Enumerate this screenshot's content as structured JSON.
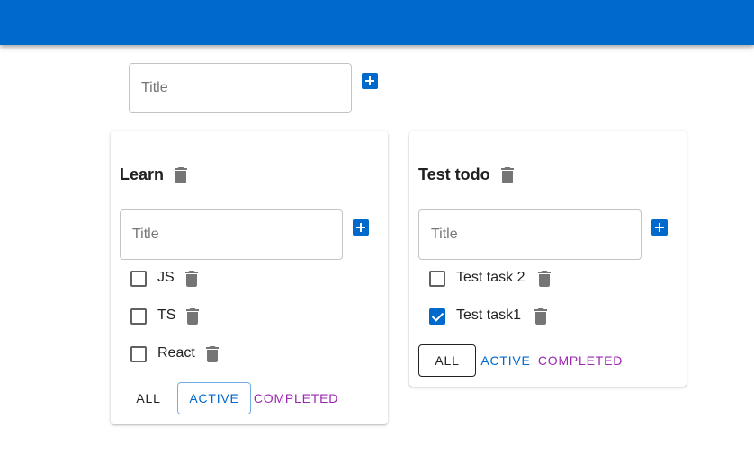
{
  "colors": {
    "primary": "#0069cc",
    "secondary": "#9c27b0",
    "text": "#212121"
  },
  "new_list": {
    "placeholder": "Title",
    "add_icon": "add-box-icon"
  },
  "lists": [
    {
      "title": "Learn",
      "input_placeholder": "Title",
      "tasks": [
        {
          "label": "JS",
          "checked": false
        },
        {
          "label": "TS",
          "checked": false
        },
        {
          "label": "React",
          "checked": false
        }
      ],
      "filters": {
        "all": "ALL",
        "active": "ACTIVE",
        "completed": "COMPLETED",
        "selected": "active"
      }
    },
    {
      "title": "Test todo",
      "input_placeholder": "Title",
      "tasks": [
        {
          "label": "Test task 2",
          "checked": false
        },
        {
          "label": "Test task1",
          "checked": true
        }
      ],
      "filters": {
        "all": "ALL",
        "active": "ACTIVE",
        "completed": "COMPLETED",
        "selected": "all"
      }
    }
  ]
}
